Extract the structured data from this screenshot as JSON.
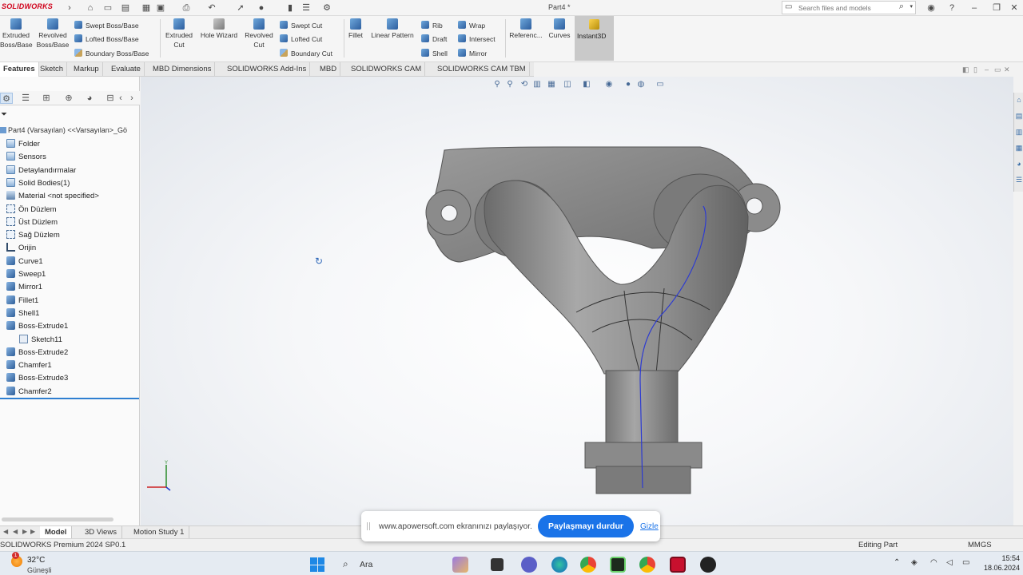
{
  "app": {
    "logo": "SOLIDWORKS",
    "doc_title": "Part4 *"
  },
  "search": {
    "placeholder": "Search files and models"
  },
  "command_manager": {
    "extruded_boss": "Extruded Boss/Base",
    "revolved_boss": "Revolved Boss/Base",
    "swept_boss": "Swept Boss/Base",
    "lofted_boss": "Lofted Boss/Base",
    "boundary_boss": "Boundary Boss/Base",
    "extruded_cut": "Extruded Cut",
    "hole_wizard": "Hole Wizard",
    "revolved_cut": "Revolved Cut",
    "swept_cut": "Swept Cut",
    "lofted_cut": "Lofted Cut",
    "boundary_cut": "Boundary Cut",
    "fillet": "Fillet",
    "linear_pattern": "Linear Pattern",
    "rib": "Rib",
    "draft": "Draft",
    "shell": "Shell",
    "wrap": "Wrap",
    "intersect": "Intersect",
    "mirror": "Mirror",
    "reference": "Referenc...",
    "curves": "Curves",
    "instant3d": "Instant3D"
  },
  "tabs": [
    "Features",
    "Sketch",
    "Markup",
    "Evaluate",
    "MBD Dimensions",
    "SOLIDWORKS Add-Ins",
    "MBD",
    "SOLIDWORKS CAM",
    "SOLIDWORKS CAM TBM"
  ],
  "feature_tree": {
    "root": "Part4 (Varsayılan) <<Varsayılan>_Gö",
    "items": [
      {
        "label": "Folder",
        "icon": "folder-icon"
      },
      {
        "label": "Sensors",
        "icon": "sensor-icon"
      },
      {
        "label": "Detaylandırmalar",
        "icon": "annotations-icon"
      },
      {
        "label": "Solid Bodies(1)",
        "icon": "solid-bodies-icon"
      },
      {
        "label": "Material <not specified>",
        "icon": "material-icon"
      },
      {
        "label": "Ön Düzlem",
        "icon": "plane-icon"
      },
      {
        "label": "Üst Düzlem",
        "icon": "plane-icon"
      },
      {
        "label": "Sağ Düzlem",
        "icon": "plane-icon"
      },
      {
        "label": "Orijin",
        "icon": "origin-icon"
      },
      {
        "label": "Curve1",
        "icon": "curve-icon"
      },
      {
        "label": "Sweep1",
        "icon": "sweep-icon"
      },
      {
        "label": "Mirror1",
        "icon": "mirror-icon"
      },
      {
        "label": "Fillet1",
        "icon": "fillet-icon"
      },
      {
        "label": "Shell1",
        "icon": "shell-icon"
      },
      {
        "label": "Boss-Extrude1",
        "icon": "extrude-icon"
      },
      {
        "label": "Sketch11",
        "icon": "sketch-icon"
      },
      {
        "label": "Boss-Extrude2",
        "icon": "extrude-icon"
      },
      {
        "label": "Chamfer1",
        "icon": "chamfer-icon"
      },
      {
        "label": "Boss-Extrude3",
        "icon": "extrude-icon"
      },
      {
        "label": "Chamfer2",
        "icon": "chamfer-icon"
      }
    ]
  },
  "model_tabs": [
    "Model",
    "3D Views",
    "Motion Study 1"
  ],
  "share_popup": {
    "message": "www.apowersoft.com ekranınızı paylaşıyor.",
    "stop_button": "Paylaşmayı durdur",
    "hide_link": "Gizle"
  },
  "status_bar": {
    "product": "SOLIDWORKS Premium 2024 SP0.1",
    "mode": "Editing Part",
    "units": "MMGS"
  },
  "taskbar": {
    "weather_badge": "1",
    "temperature": "32°C",
    "condition": "Güneşli",
    "search_label": "Ara",
    "time": "15:54",
    "date": "18.06.2024"
  },
  "colors": {
    "accent": "#1a73e8",
    "part_gray": "#8a8a8a",
    "sweep_path": "#2d3bd1",
    "logo_red": "#d0021b"
  }
}
